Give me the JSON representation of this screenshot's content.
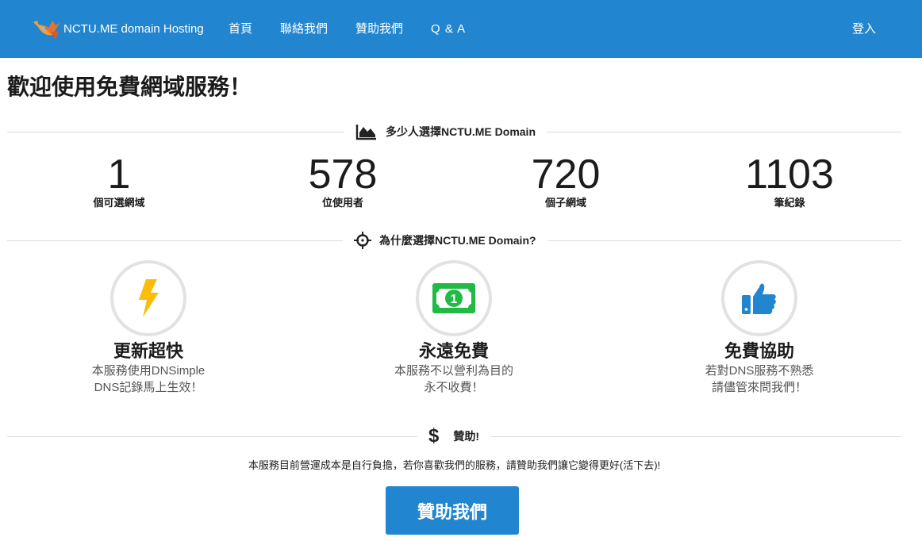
{
  "nav": {
    "brand": "NCTU.ME domain Hosting",
    "links": [
      "首頁",
      "聯絡我們",
      "贊助我們",
      "Q & A"
    ],
    "login": "登入"
  },
  "page_title": "歡迎使用免費網域服務！",
  "stats_section": {
    "heading": "多少人選擇NCTU.ME Domain",
    "icon": "area-chart-icon",
    "items": [
      {
        "value": "1",
        "label": "個可選網域"
      },
      {
        "value": "578",
        "label": "位使用者"
      },
      {
        "value": "720",
        "label": "個子網域"
      },
      {
        "value": "1103",
        "label": "筆紀錄"
      }
    ]
  },
  "why_section": {
    "heading": "為什麼選擇NCTU.ME Domain?",
    "icon": "crosshairs-icon",
    "features": [
      {
        "title": "更新超快",
        "desc1": "本服務使用DNSimple",
        "desc2": "DNS記錄馬上生效！",
        "icon": "lightning-icon",
        "color": "#fbbd08"
      },
      {
        "title": "永遠免費",
        "desc1": "本服務不以營利為目的",
        "desc2": "永不收費！",
        "icon": "money-bill-icon",
        "color": "#21ba45"
      },
      {
        "title": "免費協助",
        "desc1": "若對DNS服務不熟悉",
        "desc2": "請儘管來問我們！",
        "icon": "thumbs-up-icon",
        "color": "#2185d0"
      }
    ]
  },
  "sponsor_section": {
    "heading": "贊助!",
    "icon": "dollar-icon",
    "text": "本服務目前營運成本是自行負擔，若你喜歡我們的服務，請贊助我們讓它變得更好(活下去)!",
    "button": "贊助我們"
  },
  "colors": {
    "primary": "#2185d0",
    "yellow": "#fbbd08",
    "green": "#21ba45"
  }
}
